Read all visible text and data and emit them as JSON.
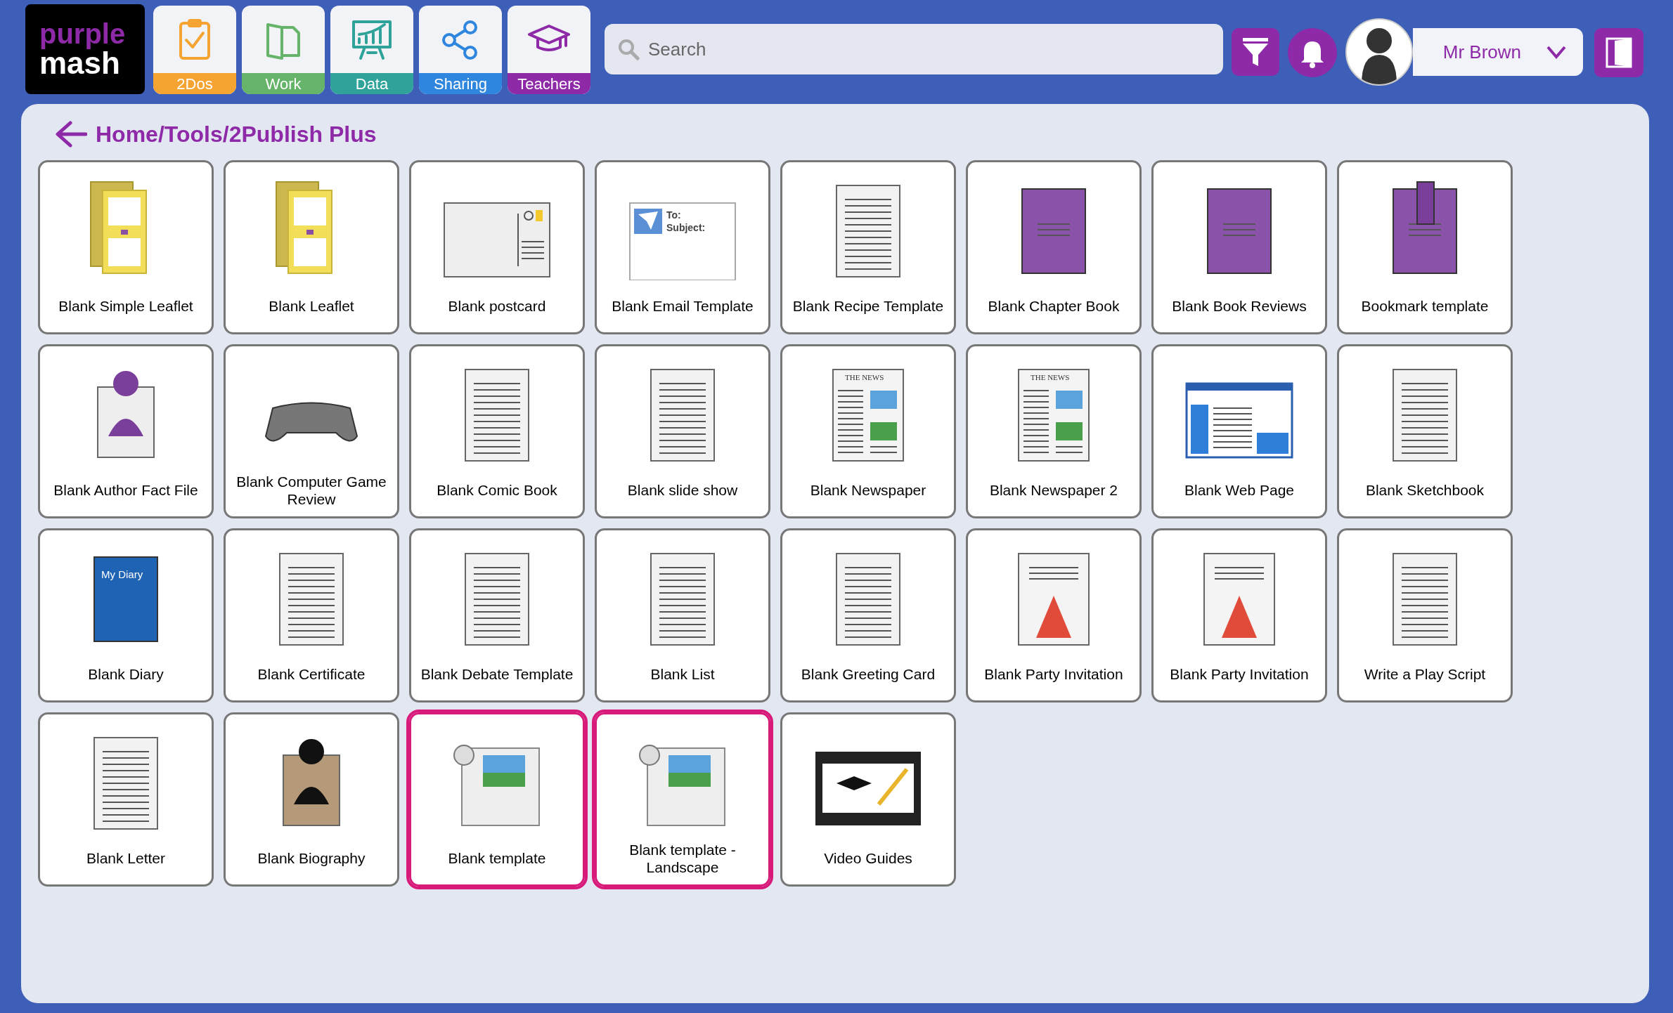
{
  "logo": {
    "line_1": "purple",
    "line_2": "mash"
  },
  "nav_tabs": [
    {
      "label": "2Dos",
      "kind": "todo",
      "color": "#f5a331"
    },
    {
      "label": "Work",
      "kind": "work",
      "color": "#66b36a"
    },
    {
      "label": "Data",
      "kind": "data",
      "color": "#2fa39a"
    },
    {
      "label": "Sharing",
      "kind": "share",
      "color": "#2e86de"
    },
    {
      "label": "Teachers",
      "kind": "teach",
      "color": "#8e2aa8"
    }
  ],
  "search": {
    "placeholder": "Search"
  },
  "user": {
    "name": "Mr Brown"
  },
  "breadcrumb": "Home/Tools/2Publish Plus",
  "tiles": [
    {
      "label": "Blank Simple Leaflet",
      "kind": "leaflet",
      "selected": false
    },
    {
      "label": "Blank Leaflet",
      "kind": "leaflet",
      "selected": false
    },
    {
      "label": "Blank postcard",
      "kind": "postcard",
      "selected": false
    },
    {
      "label": "Blank Email Template",
      "kind": "email",
      "selected": false,
      "thumb_text": [
        "To:",
        "Subject:"
      ]
    },
    {
      "label": "Blank Recipe Template",
      "kind": "doc",
      "selected": false
    },
    {
      "label": "Blank Chapter Book",
      "kind": "book",
      "selected": false
    },
    {
      "label": "Blank Book Reviews",
      "kind": "openbook",
      "selected": false
    },
    {
      "label": "Bookmark template",
      "kind": "bookmark",
      "selected": false
    },
    {
      "label": "Blank Author Fact File",
      "kind": "author",
      "selected": false
    },
    {
      "label": "Blank Computer Game Review",
      "kind": "game",
      "selected": false
    },
    {
      "label": "Blank Comic Book",
      "kind": "comic",
      "selected": false
    },
    {
      "label": "Blank slide show",
      "kind": "slide",
      "selected": false
    },
    {
      "label": "Blank Newspaper",
      "kind": "news",
      "selected": false,
      "thumb_text": [
        "THE NEWS"
      ]
    },
    {
      "label": "Blank Newspaper 2",
      "kind": "news",
      "selected": false,
      "thumb_text": [
        "THE NEWS"
      ]
    },
    {
      "label": "Blank Web Page",
      "kind": "web",
      "selected": false
    },
    {
      "label": "Blank Sketchbook",
      "kind": "sketch",
      "selected": false
    },
    {
      "label": "Blank Diary",
      "kind": "diary",
      "selected": false,
      "thumb_text": [
        "My Diary"
      ]
    },
    {
      "label": "Blank Certificate",
      "kind": "certificate",
      "selected": false
    },
    {
      "label": "Blank Debate Template",
      "kind": "doc",
      "selected": false
    },
    {
      "label": "Blank List",
      "kind": "doc",
      "selected": false
    },
    {
      "label": "Blank Greeting Card",
      "kind": "card",
      "selected": false
    },
    {
      "label": "Blank Party Invitation",
      "kind": "party",
      "selected": false
    },
    {
      "label": "Blank Party Invitation",
      "kind": "party",
      "selected": false
    },
    {
      "label": "Write a Play Script",
      "kind": "doc",
      "selected": false
    },
    {
      "label": "Blank Letter",
      "kind": "letter",
      "selected": false
    },
    {
      "label": "Blank Biography",
      "kind": "bio",
      "selected": false
    },
    {
      "label": "Blank template",
      "kind": "template",
      "selected": true
    },
    {
      "label": "Blank template - Landscape",
      "kind": "template",
      "selected": true
    },
    {
      "label": "Video Guides",
      "kind": "video",
      "selected": false
    }
  ]
}
